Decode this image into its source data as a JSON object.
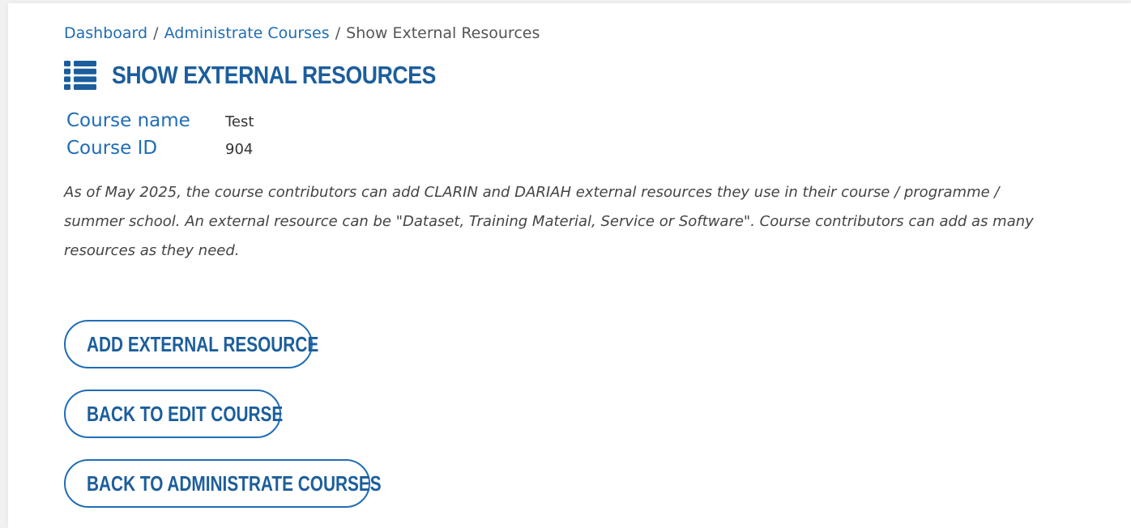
{
  "breadcrumb": {
    "items": [
      {
        "label": "Dashboard"
      },
      {
        "label": "Administrate Courses"
      },
      {
        "label": "Show External Resources"
      }
    ],
    "separator": "/"
  },
  "header": {
    "icon": "list-icon",
    "title": "SHOW EXTERNAL RESOURCES"
  },
  "course": {
    "name_label": "Course name",
    "name_value": "Test",
    "id_label": "Course ID",
    "id_value": "904"
  },
  "description": "As of May 2025, the course contributors can add CLARIN and DARIAH external resources they use in their course / programme / summer school. An external resource can be \"Dataset, Training Material, Service or Software\". Course contributors can add as many resources as they need.",
  "actions": {
    "add_label": "ADD EXTERNAL RESOURCE",
    "back_edit_label": "BACK TO EDIT COURSE",
    "back_admin_label": "BACK TO ADMINISTRATE COURSES"
  },
  "colors": {
    "link": "#1f6db5",
    "heading": "#1c5e9c",
    "text": "#444444"
  }
}
